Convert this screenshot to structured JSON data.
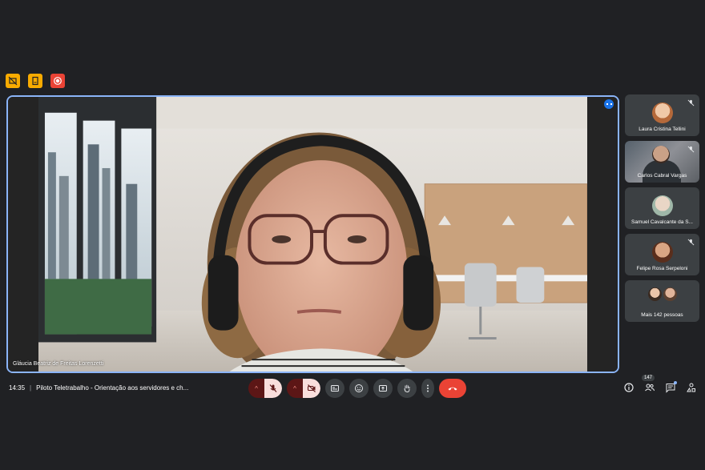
{
  "top_indicators": [
    {
      "icon": "no-camera-share-icon",
      "color": "#f9ab00"
    },
    {
      "icon": "document-icon",
      "color": "#f9ab00"
    },
    {
      "icon": "record-icon",
      "color": "#ea4335"
    }
  ],
  "stage": {
    "speaker_name": "Gláucia Beatriz de Freitas Lorenzetti",
    "border_color": "#8ab4f8"
  },
  "participants": [
    {
      "name": "Laura Cristina Tellini",
      "muted": true,
      "type": "avatar",
      "color": "#e8b89a"
    },
    {
      "name": "Carlos Cabral Vargas",
      "muted": true,
      "type": "video"
    },
    {
      "name": "Samuel Cavalcante da S...",
      "muted": false,
      "type": "avatar",
      "color": "#9fb7a8"
    },
    {
      "name": "Felipe Rosa Serpeloni",
      "muted": true,
      "type": "avatar",
      "color": "#8a4a2c"
    },
    {
      "name": "Mais 142 pessoas",
      "muted": false,
      "type": "more"
    }
  ],
  "meeting": {
    "time": "14:35",
    "separator": "|",
    "title": "Piloto Teletrabalho - Orientação aos servidores e ch..."
  },
  "controls": {
    "mic": "mic-off-icon",
    "camera": "camera-off-icon",
    "captions": "captions-icon",
    "emoji": "emoji-icon",
    "present": "present-icon",
    "hand": "raise-hand-icon",
    "more": "more-vert-icon",
    "end": "end-call-icon"
  },
  "right_controls": {
    "info": "info-icon",
    "people_count": "147",
    "chat": "chat-icon",
    "activities": "activities-icon"
  },
  "colors": {
    "background": "#202124",
    "tile": "#3c4043",
    "end_call": "#ea4335",
    "muted_bg": "#f9dedc"
  }
}
